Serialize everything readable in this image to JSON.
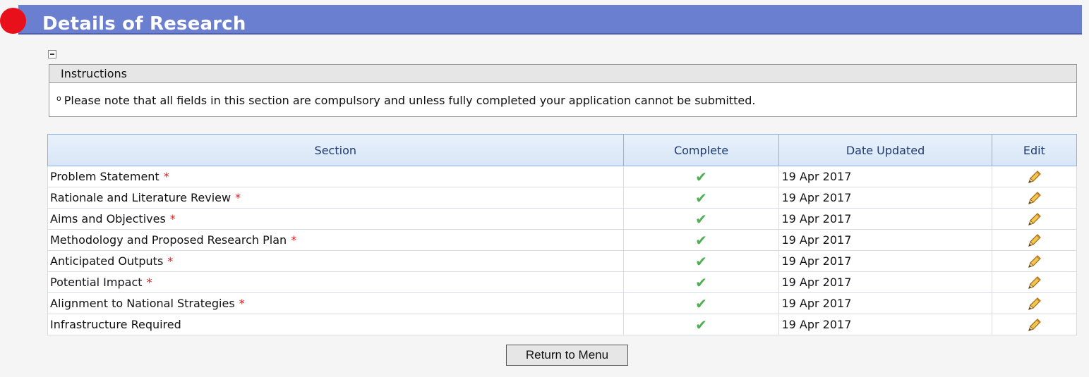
{
  "header": {
    "title": "Details of Research",
    "bar_color": "#6b7fd1",
    "dot_color": "#e8101a"
  },
  "instructions": {
    "heading": "Instructions",
    "bullet": "o",
    "text": "Please note that all fields in this section are compulsory and unless fully completed your application cannot be submitted."
  },
  "table": {
    "columns": [
      "Section",
      "Complete",
      "Date Updated",
      "Edit"
    ],
    "rows": [
      {
        "section": "Problem Statement",
        "required": "*",
        "complete": "✔",
        "date": "19 Apr 2017"
      },
      {
        "section": "Rationale and Literature Review",
        "required": "*",
        "complete": "✔",
        "date": "19 Apr 2017"
      },
      {
        "section": "Aims and Objectives",
        "required": "*",
        "complete": "✔",
        "date": "19 Apr 2017"
      },
      {
        "section": "Methodology and Proposed Research Plan",
        "required": "*",
        "complete": "✔",
        "date": "19 Apr 2017"
      },
      {
        "section": "Anticipated Outputs",
        "required": "*",
        "complete": "✔",
        "date": "19 Apr 2017"
      },
      {
        "section": "Potential Impact",
        "required": "*",
        "complete": "✔",
        "date": "19 Apr 2017"
      },
      {
        "section": "Alignment to National Strategies",
        "required": "*",
        "complete": "✔",
        "date": "19 Apr 2017"
      },
      {
        "section": "Infrastructure Required",
        "required": "",
        "complete": "✔",
        "date": "19 Apr 2017"
      }
    ]
  },
  "icons": {
    "complete": "check-icon",
    "edit": "pencil-icon",
    "collapse": "collapse-minus-icon"
  },
  "footer": {
    "return_label": "Return to Menu"
  }
}
